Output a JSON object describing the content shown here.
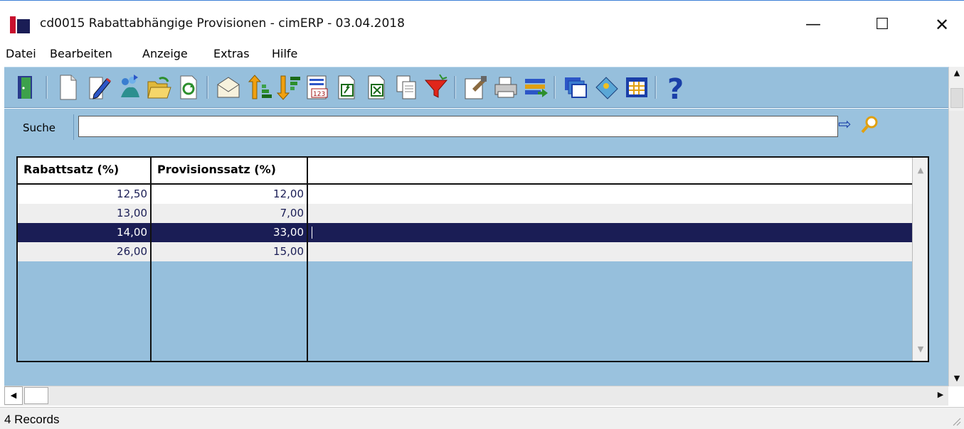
{
  "window": {
    "title": "cd0015 Rabattabhängige Provisionen - cimERP - 03.04.2018",
    "minimize_glyph": "—",
    "maximize_glyph": "☐",
    "close_glyph": "✕"
  },
  "menu": {
    "items": [
      "Datei",
      "Bearbeiten",
      "Anzeige",
      "Extras",
      "Hilfe"
    ]
  },
  "toolbar": {
    "icons": [
      "exit-door-icon",
      "new-document-icon",
      "edit-pencil-icon",
      "copy-record-icon",
      "open-folder-icon",
      "refresh-icon",
      "email-icon",
      "sort-ascending-icon",
      "sort-descending-icon",
      "number-format-icon",
      "export-icon",
      "excel-export-icon",
      "copy-icon",
      "filter-icon",
      "properties-icon",
      "print-icon",
      "transfer-icon",
      "windows-icon",
      "bookmark-icon",
      "grid-view-icon",
      "help-icon"
    ]
  },
  "search": {
    "label": "Suche",
    "value": "",
    "go_glyph": "⇨"
  },
  "grid": {
    "columns": [
      "Rabattsatz (%)",
      "Provisionssatz (%)"
    ],
    "rows": [
      {
        "rabatt": "12,50",
        "provision": "12,00"
      },
      {
        "rabatt": "13,00",
        "provision": "7,00"
      },
      {
        "rabatt": "14,00",
        "provision": "33,00"
      },
      {
        "rabatt": "26,00",
        "provision": "15,00"
      }
    ],
    "selected_row": 2
  },
  "status": {
    "text": "4 Records"
  },
  "colors": {
    "panel": "#9ac2de",
    "selection": "#1a1d55",
    "brand_red": "#c8102e"
  }
}
